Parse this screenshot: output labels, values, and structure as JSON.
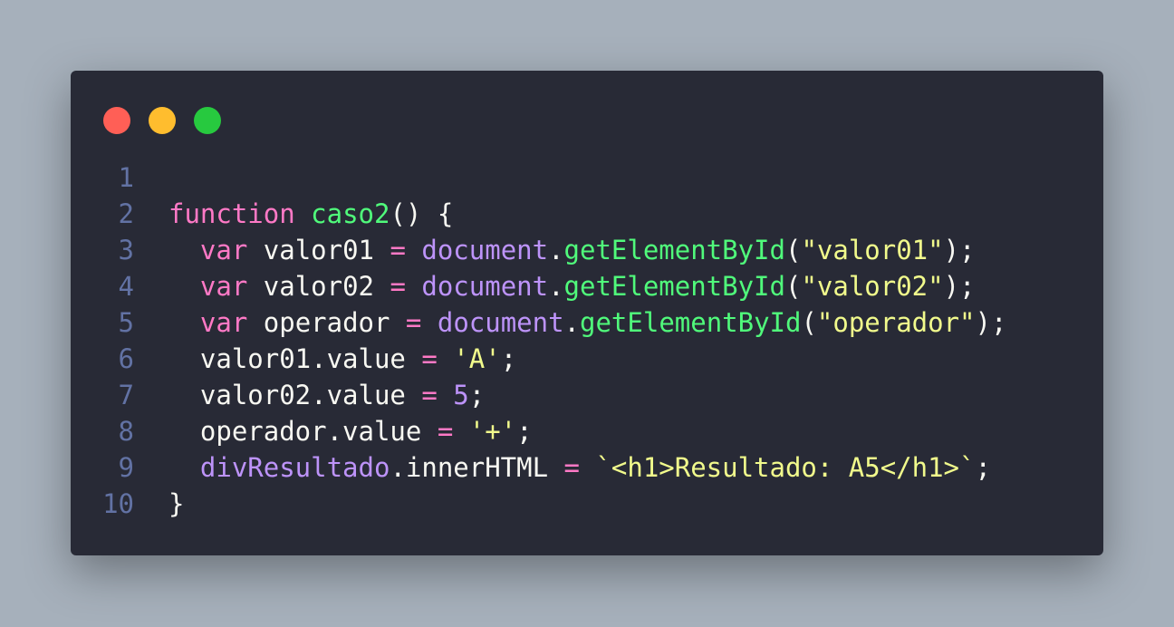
{
  "window": {
    "controls": [
      "close",
      "minimize",
      "maximize"
    ]
  },
  "colors": {
    "background": "#a6b0bb",
    "window": "#282a36",
    "keyword": "#ff79c6",
    "function": "#50fa7b",
    "object": "#bd93f9",
    "string": "#f1fa8c",
    "text": "#f8f8f2",
    "line_number": "#6272a4"
  },
  "code": {
    "lines": [
      {
        "number": "1",
        "tokens": []
      },
      {
        "number": "2",
        "tokens": [
          {
            "t": "function",
            "c": "kw"
          },
          {
            "t": " ",
            "c": "id"
          },
          {
            "t": "caso2",
            "c": "fn"
          },
          {
            "t": "() {",
            "c": "punc"
          }
        ]
      },
      {
        "number": "3",
        "tokens": [
          {
            "t": "  ",
            "c": "id"
          },
          {
            "t": "var",
            "c": "kw"
          },
          {
            "t": " valor01 ",
            "c": "id"
          },
          {
            "t": "=",
            "c": "op"
          },
          {
            "t": " ",
            "c": "id"
          },
          {
            "t": "document",
            "c": "obj"
          },
          {
            "t": ".",
            "c": "punc"
          },
          {
            "t": "getElementById",
            "c": "fn"
          },
          {
            "t": "(",
            "c": "punc"
          },
          {
            "t": "\"valor01\"",
            "c": "str"
          },
          {
            "t": ");",
            "c": "punc"
          }
        ]
      },
      {
        "number": "4",
        "tokens": [
          {
            "t": "  ",
            "c": "id"
          },
          {
            "t": "var",
            "c": "kw"
          },
          {
            "t": " valor02 ",
            "c": "id"
          },
          {
            "t": "=",
            "c": "op"
          },
          {
            "t": " ",
            "c": "id"
          },
          {
            "t": "document",
            "c": "obj"
          },
          {
            "t": ".",
            "c": "punc"
          },
          {
            "t": "getElementById",
            "c": "fn"
          },
          {
            "t": "(",
            "c": "punc"
          },
          {
            "t": "\"valor02\"",
            "c": "str"
          },
          {
            "t": ");",
            "c": "punc"
          }
        ]
      },
      {
        "number": "5",
        "tokens": [
          {
            "t": "  ",
            "c": "id"
          },
          {
            "t": "var",
            "c": "kw"
          },
          {
            "t": " operador ",
            "c": "id"
          },
          {
            "t": "=",
            "c": "op"
          },
          {
            "t": " ",
            "c": "id"
          },
          {
            "t": "document",
            "c": "obj"
          },
          {
            "t": ".",
            "c": "punc"
          },
          {
            "t": "getElementById",
            "c": "fn"
          },
          {
            "t": "(",
            "c": "punc"
          },
          {
            "t": "\"operador\"",
            "c": "str"
          },
          {
            "t": ");",
            "c": "punc"
          }
        ]
      },
      {
        "number": "6",
        "tokens": [
          {
            "t": "  valor01.value ",
            "c": "id"
          },
          {
            "t": "=",
            "c": "op"
          },
          {
            "t": " ",
            "c": "id"
          },
          {
            "t": "'A'",
            "c": "str"
          },
          {
            "t": ";",
            "c": "punc"
          }
        ]
      },
      {
        "number": "7",
        "tokens": [
          {
            "t": "  valor02.value ",
            "c": "id"
          },
          {
            "t": "=",
            "c": "op"
          },
          {
            "t": " ",
            "c": "id"
          },
          {
            "t": "5",
            "c": "num"
          },
          {
            "t": ";",
            "c": "punc"
          }
        ]
      },
      {
        "number": "8",
        "tokens": [
          {
            "t": "  operador.value ",
            "c": "id"
          },
          {
            "t": "=",
            "c": "op"
          },
          {
            "t": " ",
            "c": "id"
          },
          {
            "t": "'+'",
            "c": "str"
          },
          {
            "t": ";",
            "c": "punc"
          }
        ]
      },
      {
        "number": "9",
        "tokens": [
          {
            "t": "  ",
            "c": "id"
          },
          {
            "t": "divResultado",
            "c": "obj"
          },
          {
            "t": ".innerHTML ",
            "c": "id"
          },
          {
            "t": "=",
            "c": "op"
          },
          {
            "t": " ",
            "c": "id"
          },
          {
            "t": "`<h1>Resultado: A5</h1>`",
            "c": "str"
          },
          {
            "t": ";",
            "c": "punc"
          }
        ]
      },
      {
        "number": "10",
        "tokens": [
          {
            "t": "}",
            "c": "punc"
          }
        ]
      }
    ]
  }
}
